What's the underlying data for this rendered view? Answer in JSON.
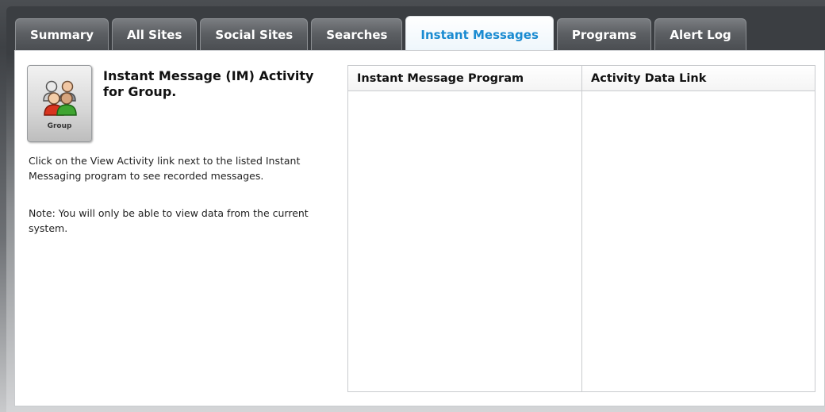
{
  "tabs": [
    {
      "label": "Summary",
      "active": false
    },
    {
      "label": "All Sites",
      "active": false
    },
    {
      "label": "Social Sites",
      "active": false
    },
    {
      "label": "Searches",
      "active": false
    },
    {
      "label": "Instant Messages",
      "active": true
    },
    {
      "label": "Programs",
      "active": false
    },
    {
      "label": "Alert Log",
      "active": false
    }
  ],
  "colors": {
    "active_tab_text": "#1a8bd1",
    "tab_bg": "#5c5f63",
    "frame_bg": "#3b3e42"
  },
  "group_icon": {
    "icon": "group-people-icon",
    "caption": "Group"
  },
  "main": {
    "heading": "Instant Message (IM) Activity for Group.",
    "description": "Click on the View Activity link next to the listed Instant Messaging program to see recorded messages.",
    "note": "Note: You will only be able to view data from the current system."
  },
  "table": {
    "columns": [
      "Instant Message Program",
      "Activity Data Link"
    ],
    "rows": []
  }
}
